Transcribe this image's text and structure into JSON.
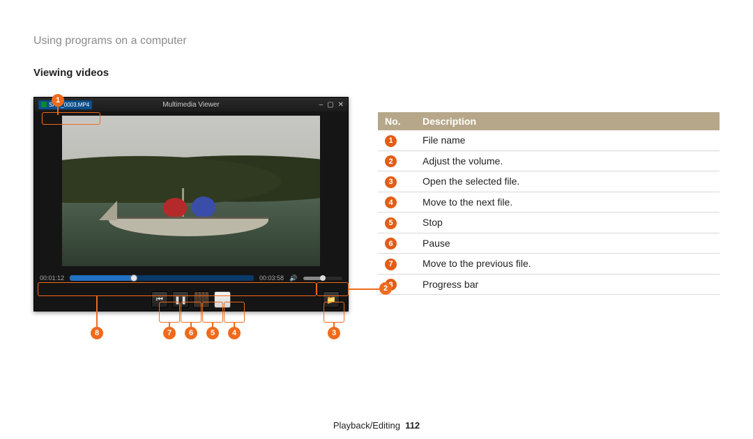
{
  "breadcrumb": "Using programs on a computer",
  "section_title": "Viewing videos",
  "viewer": {
    "filename": "SAM_0003.MP4",
    "app_title": "Multimedia Viewer",
    "win_controls": [
      "–",
      "▢",
      "✕"
    ],
    "time_elapsed": "00:01:12",
    "time_total": "00:03:58",
    "icons": {
      "vol": "🔊",
      "prev": "⏮",
      "pause": "❚❚",
      "folder": "📁"
    }
  },
  "callouts": {
    "top": "1",
    "right": "2",
    "bottom": [
      "8",
      "7",
      "6",
      "5",
      "4",
      "3"
    ]
  },
  "table": {
    "header_no": "No.",
    "header_desc": "Description",
    "rows": [
      {
        "no": "1",
        "desc": "File name"
      },
      {
        "no": "2",
        "desc": "Adjust the volume."
      },
      {
        "no": "3",
        "desc": "Open the selected file."
      },
      {
        "no": "4",
        "desc": "Move to the next file."
      },
      {
        "no": "5",
        "desc": "Stop"
      },
      {
        "no": "6",
        "desc": "Pause"
      },
      {
        "no": "7",
        "desc": "Move to the previous file."
      },
      {
        "no": "8",
        "desc": "Progress bar"
      }
    ]
  },
  "footer": {
    "chapter": "Playback/Editing",
    "page": "112"
  }
}
